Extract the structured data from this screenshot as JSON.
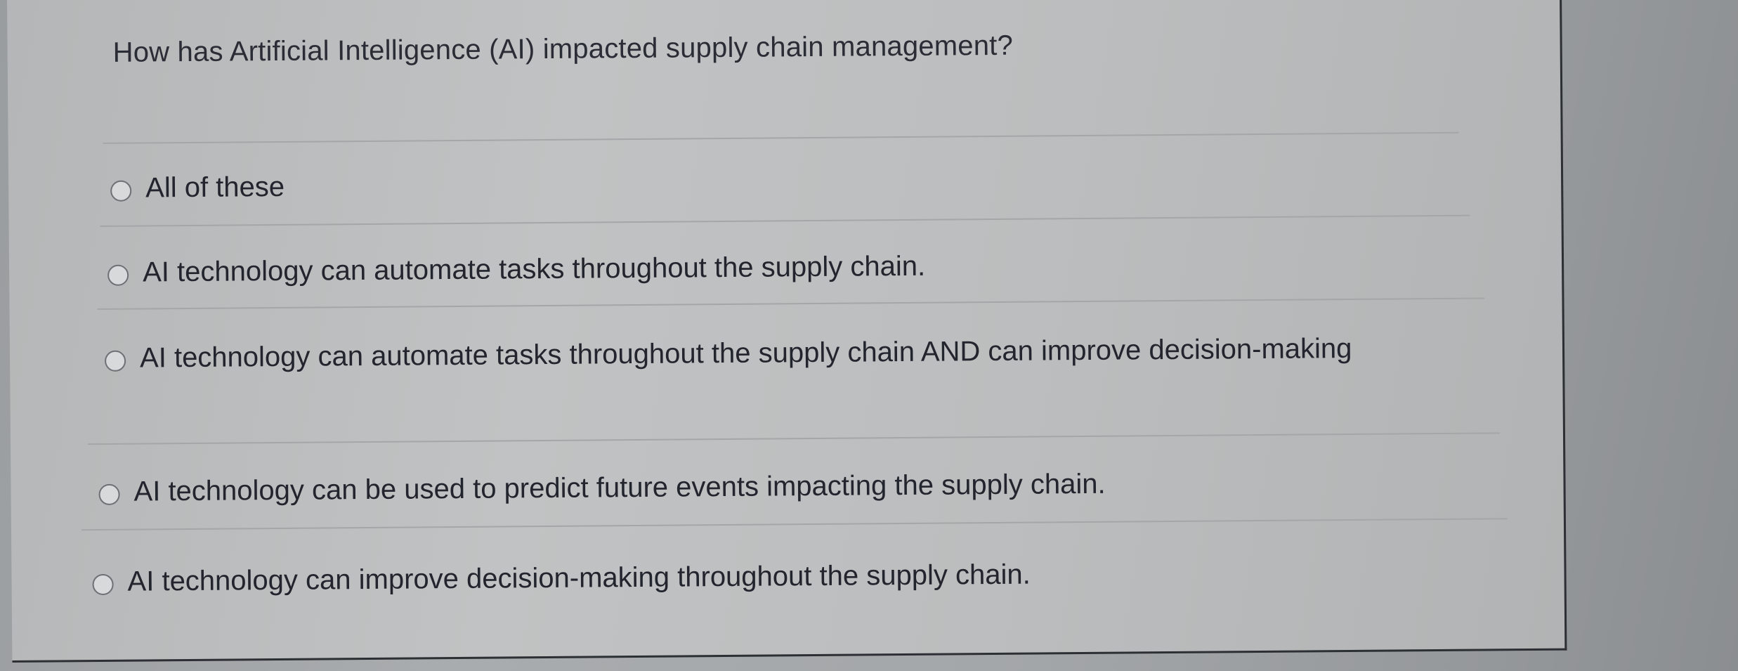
{
  "question": {
    "text": "How has Artificial Intelligence (AI) impacted supply chain management?"
  },
  "options": [
    {
      "label": "All of these",
      "selected": false
    },
    {
      "label": "AI technology can automate tasks throughout the supply chain.",
      "selected": false
    },
    {
      "label": "AI technology can automate tasks throughout the supply chain AND can improve decision-making",
      "selected": false
    },
    {
      "label": "AI technology can be used to predict future events impacting the supply chain.",
      "selected": false
    },
    {
      "label": "AI technology can improve decision-making throughout the supply chain.",
      "selected": false
    }
  ]
}
